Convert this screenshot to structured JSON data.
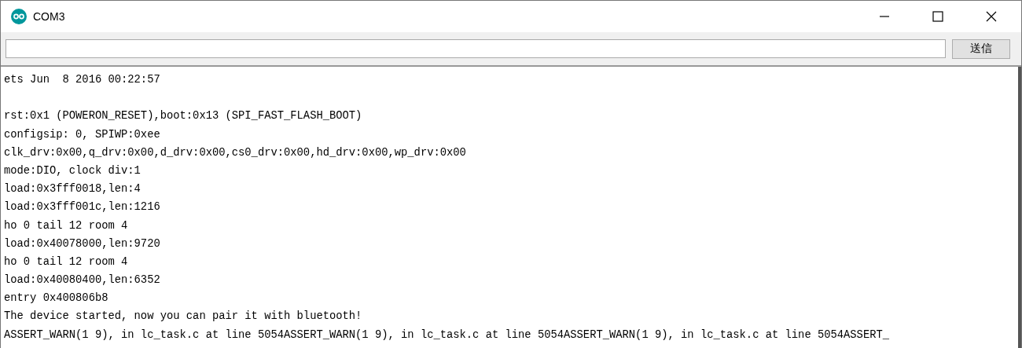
{
  "window": {
    "title": "COM3"
  },
  "send": {
    "button": "送信"
  },
  "output": [
    [
      "ets Jun  8 2016 00:22:57"
    ],
    [
      "rst:0x1 (POWERON_RESET),boot:0x13 (SPI_FAST_FLASH_BOOT)",
      "configsip: 0, SPIWP:0xee",
      "clk_drv:0x00,q_drv:0x00,d_drv:0x00,cs0_drv:0x00,hd_drv:0x00,wp_drv:0x00",
      "mode:DIO, clock div:1",
      "load:0x3fff0018,len:4",
      "load:0x3fff001c,len:1216",
      "ho 0 tail 12 room 4",
      "load:0x40078000,len:9720",
      "ho 0 tail 12 room 4",
      "load:0x40080400,len:6352",
      "entry 0x400806b8",
      "The device started, now you can pair it with bluetooth!",
      "ASSERT_WARN(1 9), in lc_task.c at line 5054ASSERT_WARN(1 9), in lc_task.c at line 5054ASSERT_WARN(1 9), in lc_task.c at line 5054ASSERT_"
    ]
  ]
}
